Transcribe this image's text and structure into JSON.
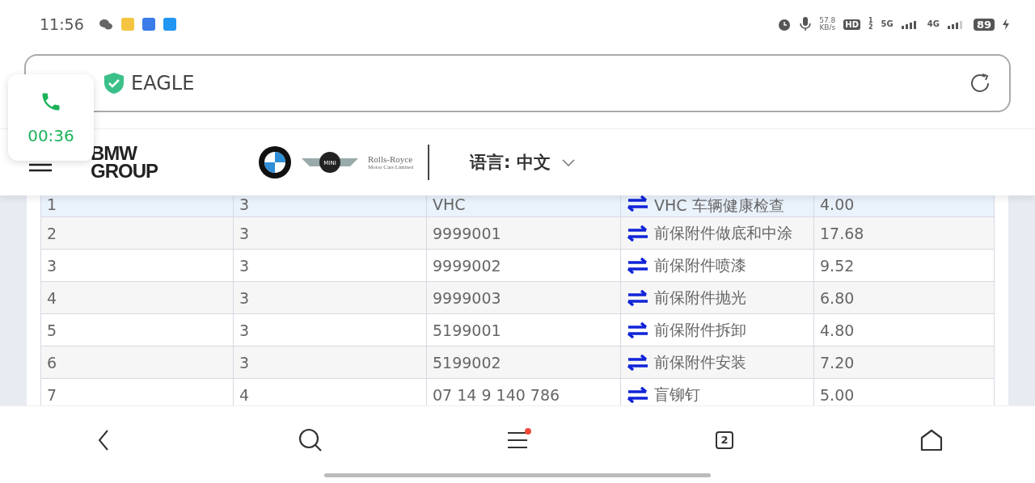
{
  "status_bar": {
    "time": "11:56",
    "net_speed": "57.8",
    "net_unit": "KB/s",
    "hd": "HD",
    "sim_slots": "1\n2",
    "network_1": "5G",
    "network_2": "4G",
    "battery": "89"
  },
  "call_widget": {
    "timer": "00:36"
  },
  "address_bar": {
    "title": "EAGLE"
  },
  "header": {
    "brand_lines": [
      "BMW",
      "GROUP"
    ],
    "rolls_royce": "Rolls-Royce",
    "rolls_royce_sub": "Motor Cars Limited",
    "mini": "MINI",
    "language": "语言: 中文"
  },
  "table": {
    "rows": [
      {
        "cells": [
          "1",
          "3",
          "VHC",
          "VHC 车辆健康检查",
          "4.00"
        ],
        "selected": true
      },
      {
        "cells": [
          "2",
          "3",
          "9999001",
          "前保附件做底和中涂",
          "17.68"
        ],
        "selected": false
      },
      {
        "cells": [
          "3",
          "3",
          "9999002",
          "前保附件喷漆",
          "9.52"
        ],
        "selected": false
      },
      {
        "cells": [
          "4",
          "3",
          "9999003",
          "前保附件抛光",
          "6.80"
        ],
        "selected": false
      },
      {
        "cells": [
          "5",
          "3",
          "5199001",
          "前保附件拆卸",
          "4.80"
        ],
        "selected": false
      },
      {
        "cells": [
          "6",
          "3",
          "5199002",
          "前保附件安装",
          "7.20"
        ],
        "selected": false
      },
      {
        "cells": [
          "7",
          "4",
          "07 14 9 140 786",
          "盲铆钉",
          "5.00"
        ],
        "selected": false
      }
    ]
  },
  "bottom_nav": {
    "tab_count": "2",
    "menu_notification": true
  }
}
